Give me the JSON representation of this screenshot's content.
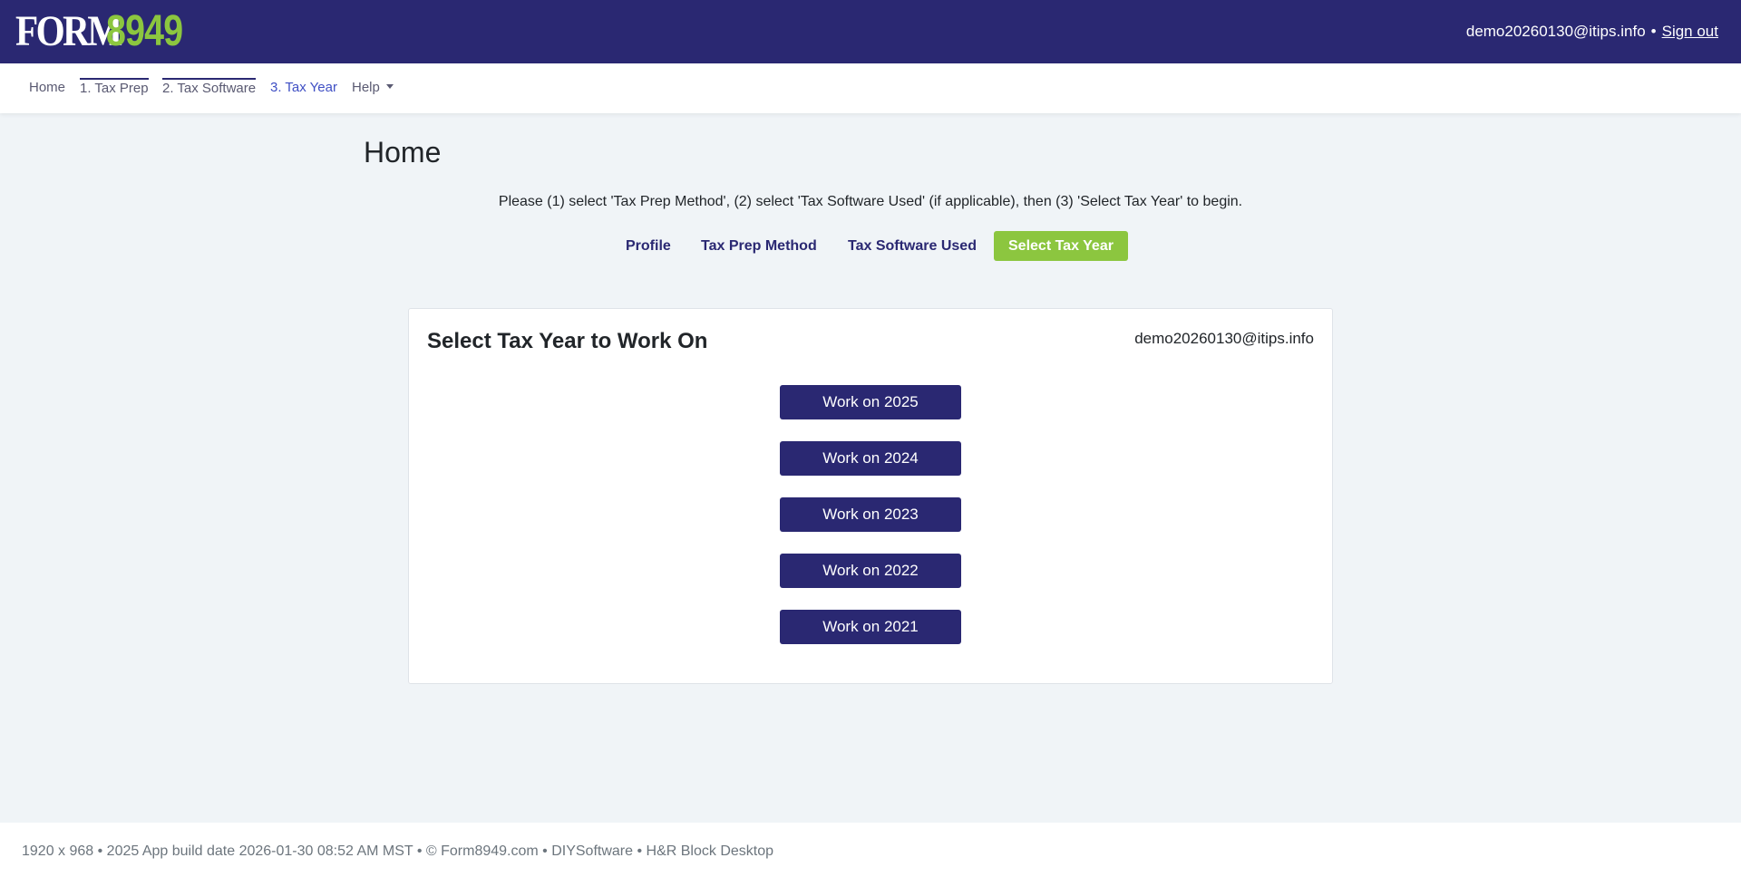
{
  "header": {
    "logo_text_form": "FORM",
    "logo_text_num": "8949",
    "user_email": "demo20260130@itips.info",
    "separator": "•",
    "signout_label": "Sign out"
  },
  "nav": {
    "items": [
      {
        "label": "Home"
      },
      {
        "label": "1. Tax Prep"
      },
      {
        "label": "2. Tax Software"
      },
      {
        "label": "3. Tax Year"
      },
      {
        "label": "Help"
      }
    ]
  },
  "main": {
    "title": "Home",
    "instructions": "Please (1) select 'Tax Prep Method', (2) select 'Tax Software Used' (if applicable), then (3) 'Select Tax Year' to begin.",
    "steps": [
      {
        "label": "Profile"
      },
      {
        "label": "Tax Prep Method"
      },
      {
        "label": "Tax Software Used"
      },
      {
        "label": "Select Tax Year"
      }
    ]
  },
  "card": {
    "title": "Select Tax Year to Work On",
    "email": "demo20260130@itips.info",
    "buttons": [
      {
        "label": "Work on 2025"
      },
      {
        "label": "Work on 2024"
      },
      {
        "label": "Work on 2023"
      },
      {
        "label": "Work on 2022"
      },
      {
        "label": "Work on 2021"
      }
    ]
  },
  "footer": {
    "text": "1920 x 968 • 2025 App build date 2026-01-30 08:52 AM MST • © Form8949.com • DIYSoftware • H&R Block Desktop"
  },
  "colors": {
    "brand_navy": "#2a2872",
    "brand_green": "#8cc63f",
    "active_nav": "#3f4fc4"
  }
}
